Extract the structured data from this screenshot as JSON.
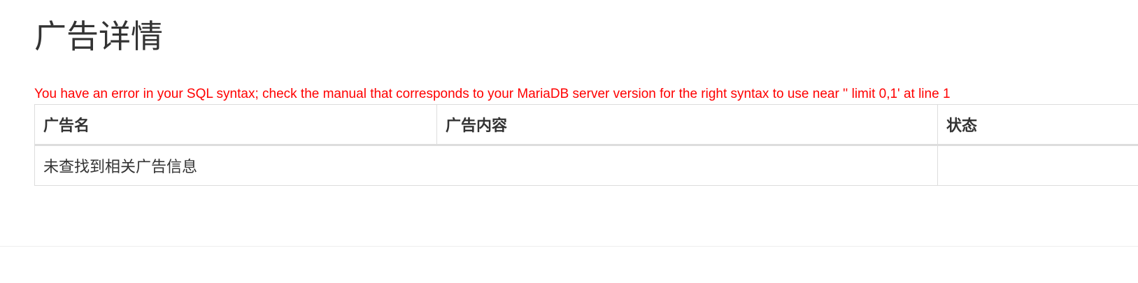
{
  "page": {
    "title": "广告详情"
  },
  "error": {
    "message": "You have an error in your SQL syntax; check the manual that corresponds to your MariaDB server version for the right syntax to use near '' limit 0,1' at line 1",
    "color": "#ff0000"
  },
  "table": {
    "headers": [
      "广告名",
      "广告内容",
      "状态"
    ],
    "empty_message": "未查找到相关广告信息",
    "empty_status": ""
  }
}
